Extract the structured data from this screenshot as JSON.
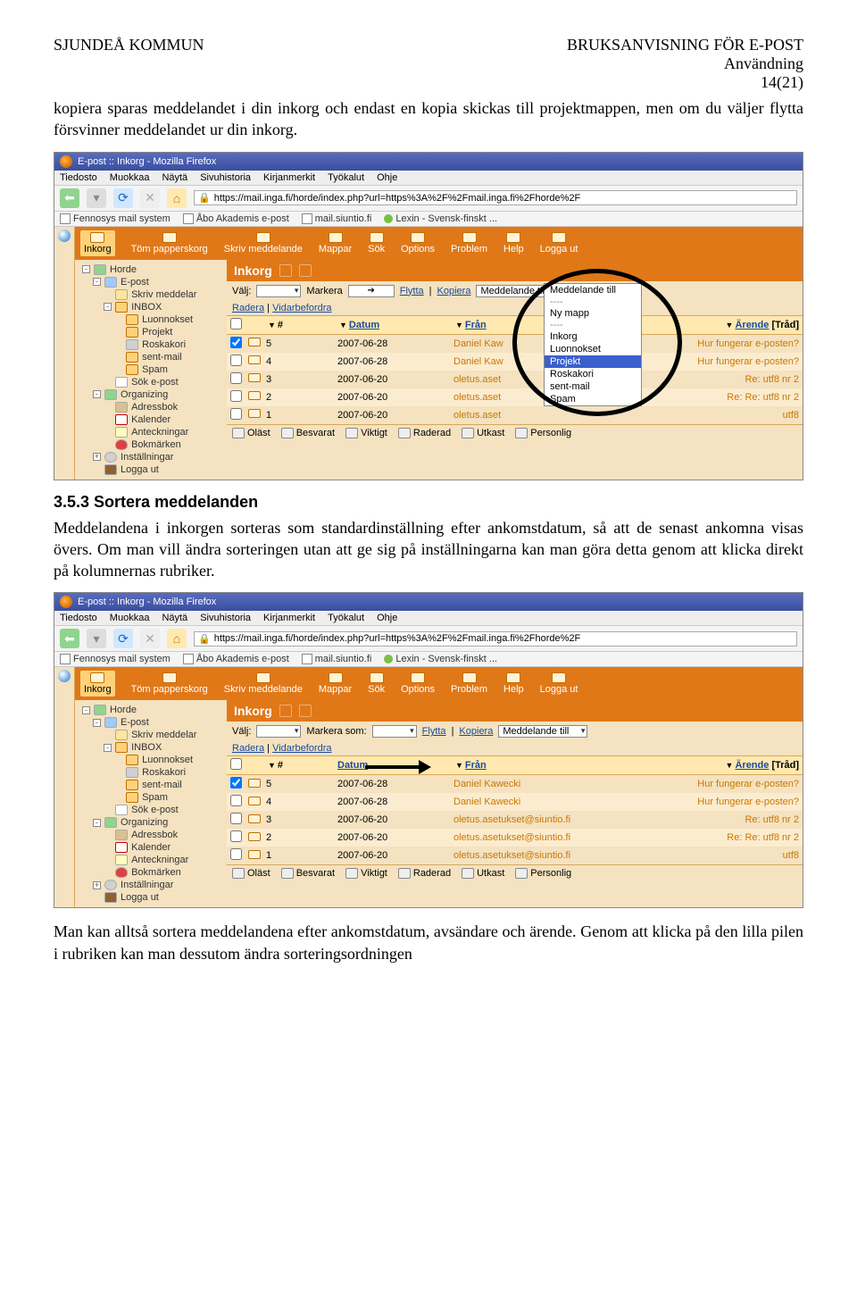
{
  "doc": {
    "header_left": "SJUNDEÅ KOMMUN",
    "header_right_1": "BRUKSANVISNING FÖR E-POST",
    "header_right_2": "Användning",
    "header_right_3": "14(21)",
    "para1": "kopiera sparas meddelandet i din inkorg och endast en kopia skickas till projektmappen, men om du väljer flytta försvinner meddelandet ur din inkorg.",
    "heading": "3.5.3 Sortera meddelanden",
    "para2": "Meddelandena i inkorgen sorteras som standardinställning efter ankomstdatum, så att de senast ankomna visas övers. Om man vill ändra sorteringen utan att ge sig på inställningarna kan man göra detta genom att klicka direkt på kolumnernas rubriker.",
    "para3": "Man kan alltså sortera meddelandena efter ankomstdatum, avsändare och ärende. Genom att klicka på den lilla pilen i rubriken kan man dessutom ändra sorteringsordningen"
  },
  "browser": {
    "window_title": "E-post :: Inkorg - Mozilla Firefox",
    "menu": [
      "Tiedosto",
      "Muokkaa",
      "Näytä",
      "Sivuhistoria",
      "Kirjanmerkit",
      "Työkalut",
      "Ohje"
    ],
    "url": "https://mail.inga.fi/horde/index.php?url=https%3A%2F%2Fmail.inga.fi%2Fhorde%2F",
    "bookmarks": [
      "Fennosys mail system",
      "Åbo Akademis e-post",
      "mail.siuntio.fi",
      "Lexin - Svensk-finskt ..."
    ]
  },
  "toolbar": {
    "items": [
      "Inkorg",
      "Töm papperskorg",
      "Skriv meddelande",
      "Mappar",
      "Sök",
      "Options",
      "Problem",
      "Help",
      "Logga ut"
    ]
  },
  "sidebar1": {
    "items": [
      {
        "label": "Horde",
        "icon": "ic-green",
        "indent": 0,
        "exp": "-"
      },
      {
        "label": "E-post",
        "icon": "ic-blue",
        "indent": 1,
        "exp": "-"
      },
      {
        "label": "Skriv meddelar",
        "icon": "ic-yellow",
        "indent": 2,
        "exp": ""
      },
      {
        "label": "INBOX",
        "icon": "ic-folder",
        "indent": 2,
        "exp": "-"
      },
      {
        "label": "Luonnokset",
        "icon": "ic-folder",
        "indent": 3,
        "exp": ""
      },
      {
        "label": "Projekt",
        "icon": "ic-folder",
        "indent": 3,
        "exp": ""
      },
      {
        "label": "Roskakori",
        "icon": "ic-trash",
        "indent": 3,
        "exp": ""
      },
      {
        "label": "sent-mail",
        "icon": "ic-folder",
        "indent": 3,
        "exp": ""
      },
      {
        "label": "Spam",
        "icon": "ic-folder",
        "indent": 3,
        "exp": ""
      },
      {
        "label": "Sök e-post",
        "icon": "ic-search",
        "indent": 2,
        "exp": ""
      },
      {
        "label": "Organizing",
        "icon": "ic-green",
        "indent": 1,
        "exp": "-"
      },
      {
        "label": "Adressbok",
        "icon": "ic-book",
        "indent": 2,
        "exp": ""
      },
      {
        "label": "Kalender",
        "icon": "ic-cal",
        "indent": 2,
        "exp": ""
      },
      {
        "label": "Anteckningar",
        "icon": "ic-note",
        "indent": 2,
        "exp": ""
      },
      {
        "label": "Bokmärken",
        "icon": "ic-heart",
        "indent": 2,
        "exp": ""
      },
      {
        "label": "Inställningar",
        "icon": "ic-gear",
        "indent": 1,
        "exp": "+"
      },
      {
        "label": "Logga ut",
        "icon": "ic-door",
        "indent": 1,
        "exp": ""
      }
    ]
  },
  "sidebar2": {
    "items": [
      {
        "label": "Horde",
        "icon": "ic-green",
        "indent": 0,
        "exp": "-"
      },
      {
        "label": "E-post",
        "icon": "ic-blue",
        "indent": 1,
        "exp": "-"
      },
      {
        "label": "Skriv meddelar",
        "icon": "ic-yellow",
        "indent": 2,
        "exp": ""
      },
      {
        "label": "INBOX",
        "icon": "ic-folder",
        "indent": 2,
        "exp": "-"
      },
      {
        "label": "Luonnokset",
        "icon": "ic-folder",
        "indent": 3,
        "exp": ""
      },
      {
        "label": "Roskakori",
        "icon": "ic-trash",
        "indent": 3,
        "exp": ""
      },
      {
        "label": "sent-mail",
        "icon": "ic-folder",
        "indent": 3,
        "exp": ""
      },
      {
        "label": "Spam",
        "icon": "ic-folder",
        "indent": 3,
        "exp": ""
      },
      {
        "label": "Sök e-post",
        "icon": "ic-search",
        "indent": 2,
        "exp": ""
      },
      {
        "label": "Organizing",
        "icon": "ic-green",
        "indent": 1,
        "exp": "-"
      },
      {
        "label": "Adressbok",
        "icon": "ic-book",
        "indent": 2,
        "exp": ""
      },
      {
        "label": "Kalender",
        "icon": "ic-cal",
        "indent": 2,
        "exp": ""
      },
      {
        "label": "Anteckningar",
        "icon": "ic-note",
        "indent": 2,
        "exp": ""
      },
      {
        "label": "Bokmärken",
        "icon": "ic-heart",
        "indent": 2,
        "exp": ""
      },
      {
        "label": "Inställningar",
        "icon": "ic-gear",
        "indent": 1,
        "exp": "+"
      },
      {
        "label": "Logga ut",
        "icon": "ic-door",
        "indent": 1,
        "exp": ""
      }
    ]
  },
  "filter": {
    "valj_label": "Välj:",
    "markera_label": "Markera",
    "markera_som_label": "Markera som:",
    "flytta_label": "Flytta",
    "kopiera_label": "Kopiera",
    "meddelande_till_label": "Meddelande till",
    "radera_label": "Radera",
    "vidarebefordra_label": "Vidarbefordra"
  },
  "dropdown": {
    "header": "Meddelande till",
    "ny_mapp": "Ny mapp",
    "rows": [
      "Inkorg",
      "Luonnokset",
      "Projekt",
      "Roskakori",
      "sent-mail",
      "Spam"
    ],
    "selected_index": 2
  },
  "table": {
    "col_num": "#",
    "col_date": "Datum",
    "col_from": "Från",
    "col_subj": "Ärende",
    "thread": "[Tråd]",
    "rows": [
      {
        "n": "5",
        "date": "2007-06-28",
        "from": "Daniel Kaw",
        "subj": "Hur fungerar e-posten?",
        "from2": "Daniel Kawecki"
      },
      {
        "n": "4",
        "date": "2007-06-28",
        "from": "Daniel Kaw",
        "subj": "Hur fungerar e-posten?",
        "from2": "Daniel Kawecki"
      },
      {
        "n": "3",
        "date": "2007-06-20",
        "from": "oletus.aset",
        "subj": "Re: utf8 nr 2",
        "from2": "oletus.asetukset@siuntio.fi"
      },
      {
        "n": "2",
        "date": "2007-06-20",
        "from": "oletus.aset",
        "subj": "Re: Re: utf8 nr 2",
        "from2": "oletus.asetukset@siuntio.fi"
      },
      {
        "n": "1",
        "date": "2007-06-20",
        "from": "oletus.aset",
        "subj": "utf8",
        "from2": "oletus.asetukset@siuntio.fi"
      }
    ]
  },
  "legend": [
    "Oläst",
    "Besvarat",
    "Viktigt",
    "Raderad",
    "Utkast",
    "Personlig"
  ],
  "inkorg_title": "Inkorg"
}
